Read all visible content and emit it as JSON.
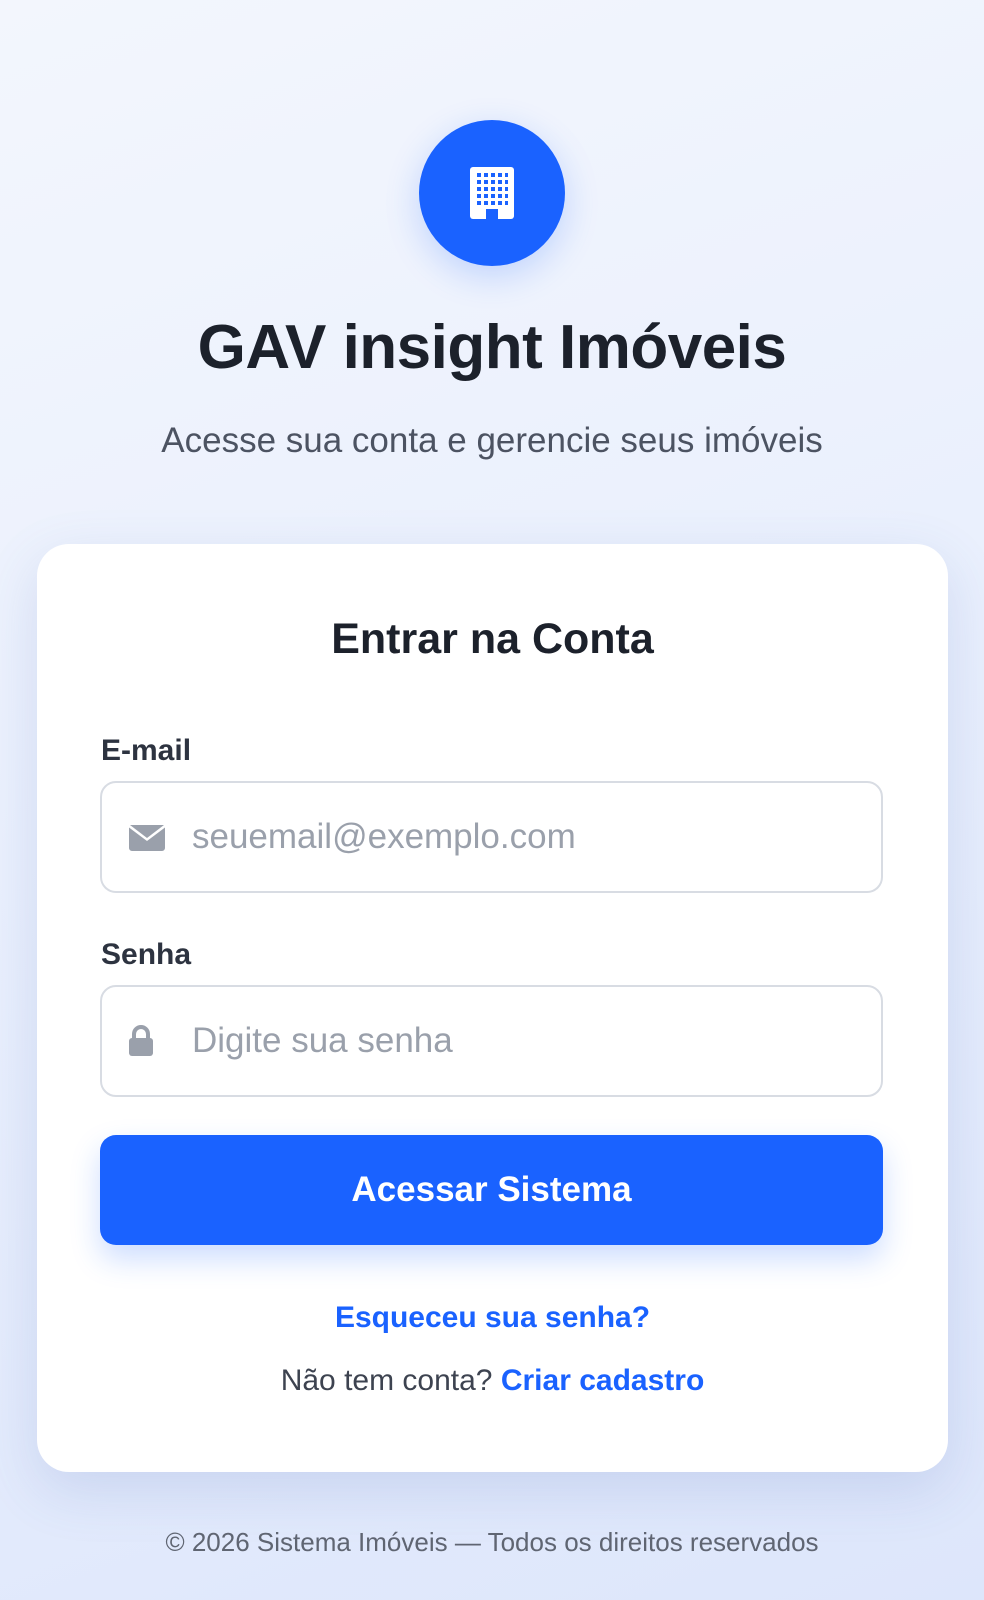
{
  "brand": {
    "logo_icon": "building-icon",
    "title": "GAV insight Imóveis",
    "subtitle": "Acesse sua conta e gerencie seus imóveis",
    "accent_color": "#1a62ff"
  },
  "login_card": {
    "title": "Entrar na Conta",
    "email": {
      "label": "E-mail",
      "icon": "envelope-icon",
      "placeholder": "seuemail@exemplo.com",
      "value": ""
    },
    "password": {
      "label": "Senha",
      "icon": "lock-icon",
      "placeholder": "Digite sua senha",
      "value": ""
    },
    "submit_label": "Acessar Sistema",
    "forgot_password_link": "Esqueceu sua senha?",
    "signup_prompt": "Não tem conta?",
    "signup_link": "Criar cadastro"
  },
  "footer": {
    "text": "© 2026 Sistema Imóveis — Todos os direitos reservados"
  }
}
